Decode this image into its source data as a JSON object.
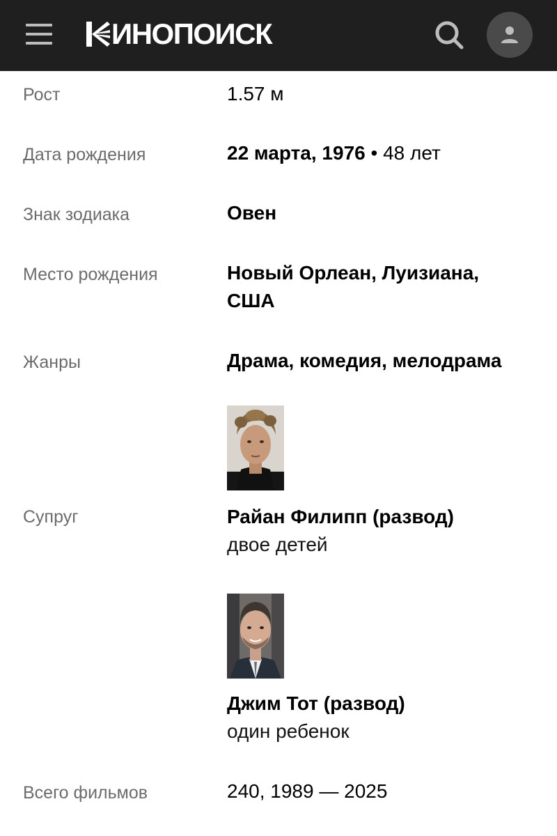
{
  "header": {
    "logo_text": "ИНОПОИСК",
    "brand_color": "#1f1f1f"
  },
  "details": {
    "height": {
      "label": "Рост",
      "value": "1.57 м"
    },
    "birth_date": {
      "label": "Дата рождения",
      "date": "22 марта, 1976",
      "separator": " • ",
      "age": "48 лет"
    },
    "zodiac": {
      "label": "Знак зодиака",
      "value": "Овен"
    },
    "birthplace": {
      "label": "Место рождения",
      "line1": "Новый Орлеан, Луизиана,",
      "line2": "США"
    },
    "genres": {
      "label": "Жанры",
      "value": "Драма, комедия, мелодрама"
    },
    "spouse": {
      "label": "Супруг",
      "items": [
        {
          "name": "Райан Филипп (развод)",
          "note": "двое детей"
        },
        {
          "name": "Джим Тот (развод)",
          "note": "один ребенок"
        }
      ]
    },
    "films": {
      "label": "Всего фильмов",
      "value": "240, 1989 — 2025"
    }
  },
  "icons": [
    "menu-icon",
    "kinopoisk-logo-icon",
    "search-icon",
    "user-icon"
  ]
}
